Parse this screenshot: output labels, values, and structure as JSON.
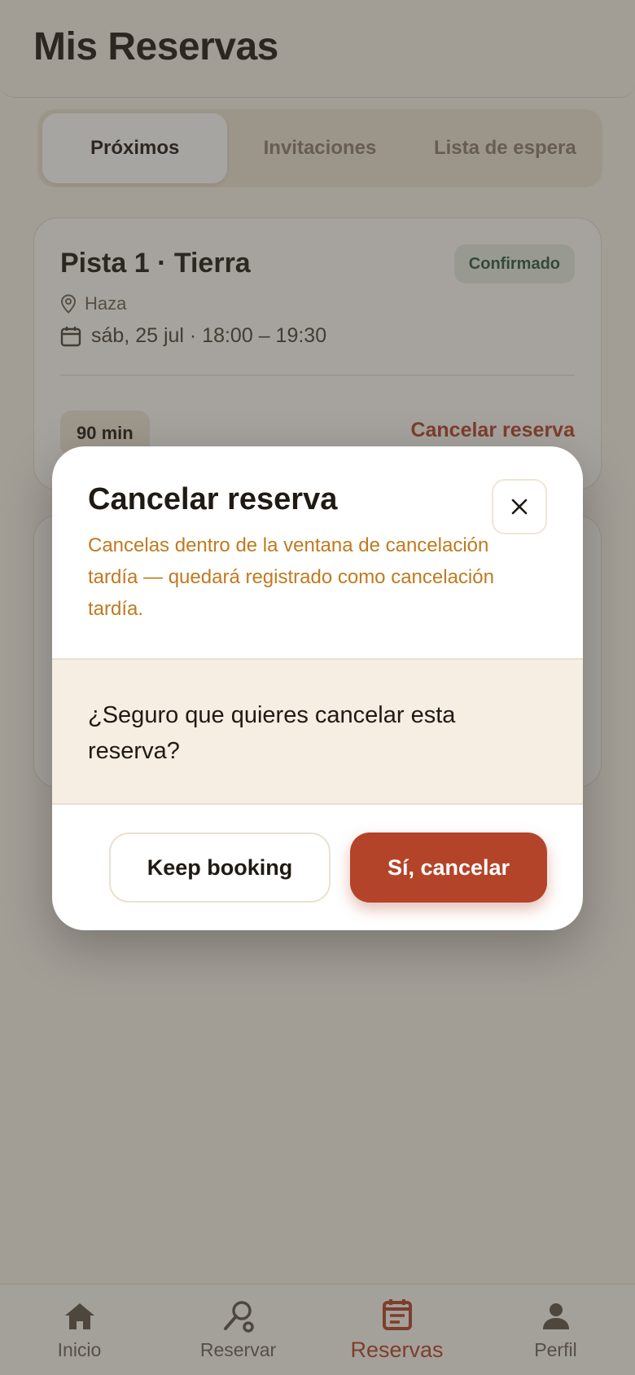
{
  "header": {
    "title": "Mis Reservas"
  },
  "tabs": [
    {
      "label": "Próximos",
      "active": true
    },
    {
      "label": "Invitaciones",
      "active": false
    },
    {
      "label": "Lista de espera",
      "active": false
    }
  ],
  "booking": {
    "court": "Pista 1 · Tierra",
    "status": "Confirmado",
    "location": "Haza",
    "datetime": "sáb, 25 jul · 18:00 – 19:30",
    "duration": "90 min",
    "cancel_label": "Cancelar reserva"
  },
  "modal": {
    "title": "Cancelar reserva",
    "warning": "Cancelas dentro de la ventana de cancelación tardía — quedará registrado como cancelación tardía.",
    "question": "¿Seguro que quieres cancelar esta reserva?",
    "keep_label": "Keep booking",
    "confirm_label": "Sí, cancelar"
  },
  "nav": [
    {
      "label": "Inicio",
      "icon": "home-icon",
      "active": false
    },
    {
      "label": "Reservar",
      "icon": "racket-icon",
      "active": false
    },
    {
      "label": "Reservas",
      "icon": "calendar-icon",
      "active": true
    },
    {
      "label": "Perfil",
      "icon": "person-icon",
      "active": false
    }
  ],
  "colors": {
    "accent": "#b3442a",
    "warning": "#c07a1f",
    "confirmed": "#2d5a3b",
    "background": "#f6f1e8"
  }
}
